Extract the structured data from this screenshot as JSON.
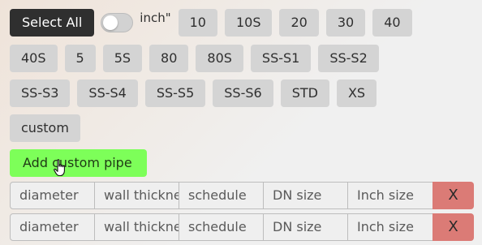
{
  "toolbar": {
    "select_all_label": "Select All",
    "unit_label": "inch\"",
    "unit_toggle_on": false
  },
  "schedules": [
    "10",
    "10S",
    "20",
    "30",
    "40",
    "40S",
    "5",
    "5S",
    "80",
    "80S",
    "SS-S1",
    "SS-S2",
    "SS-S3",
    "SS-S4",
    "SS-S5",
    "SS-S6",
    "STD",
    "XS",
    "custom"
  ],
  "add_custom_label": "Add custom pipe",
  "pipe_rows": [
    {
      "diameter": "",
      "wall": "",
      "schedule": "",
      "dn": "",
      "inch": "",
      "remove_label": "X"
    },
    {
      "diameter": "",
      "wall": "",
      "schedule": "",
      "dn": "",
      "inch": "",
      "remove_label": "X"
    }
  ],
  "placeholders": {
    "diameter": "diameter",
    "wall": "wall thickness",
    "schedule": "schedule",
    "dn": "DN size",
    "inch": "Inch size"
  },
  "colors": {
    "dark_button": "#2f2f2f",
    "chip": "#d4d4d4",
    "add_button": "#7dff59",
    "remove_button": "#db7b76"
  },
  "icons": {
    "cursor": "hand-pointer-icon"
  }
}
